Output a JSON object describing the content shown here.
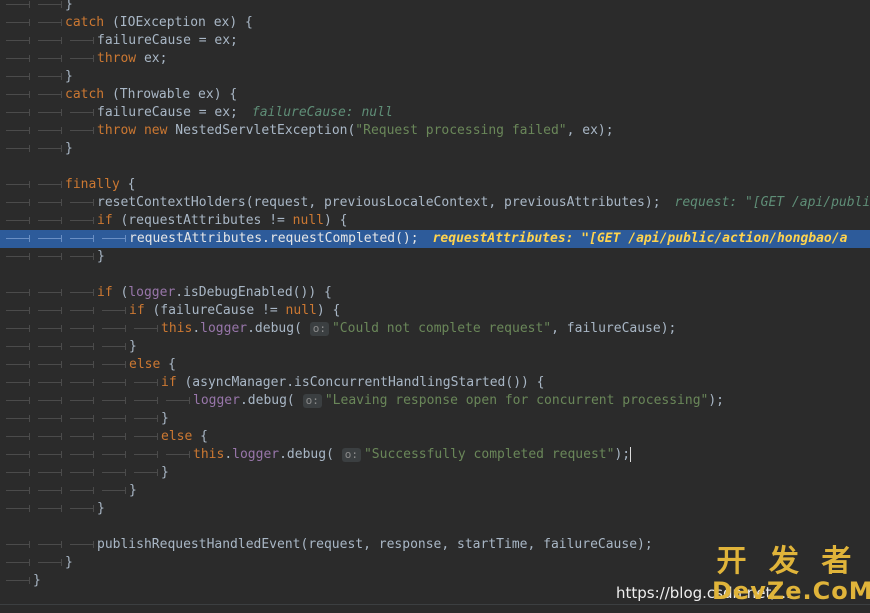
{
  "editor": {
    "lines": [
      {
        "indent": 2,
        "segs": [
          [
            "p",
            "}"
          ]
        ]
      },
      {
        "indent": 2,
        "segs": [
          [
            "k",
            "catch"
          ],
          [
            "p",
            " (IOException ex) {"
          ]
        ]
      },
      {
        "indent": 3,
        "segs": [
          [
            "p",
            "failureCause = ex;"
          ]
        ]
      },
      {
        "indent": 3,
        "segs": [
          [
            "k",
            "throw"
          ],
          [
            "p",
            " ex;"
          ]
        ]
      },
      {
        "indent": 2,
        "segs": [
          [
            "p",
            "}"
          ]
        ]
      },
      {
        "indent": 2,
        "segs": [
          [
            "k",
            "catch"
          ],
          [
            "p",
            " (Throwable ex) {"
          ]
        ]
      },
      {
        "indent": 3,
        "segs": [
          [
            "p",
            "failureCause = ex;"
          ],
          [
            "h",
            "failureCause: null"
          ]
        ]
      },
      {
        "indent": 3,
        "segs": [
          [
            "k",
            "throw new"
          ],
          [
            "p",
            " NestedServletException("
          ],
          [
            "s",
            "\"Request processing failed\""
          ],
          [
            "p",
            ", ex);"
          ]
        ]
      },
      {
        "indent": 2,
        "segs": [
          [
            "p",
            "}"
          ]
        ]
      },
      {
        "indent": 0,
        "segs": []
      },
      {
        "indent": 2,
        "segs": [
          [
            "k",
            "finally"
          ],
          [
            "p",
            " {"
          ]
        ]
      },
      {
        "indent": 3,
        "segs": [
          [
            "p",
            "resetContextHolders(request, previousLocaleContext, previousAttributes);"
          ],
          [
            "h",
            "request: \"[GET /api/public/action/hongbao/"
          ]
        ]
      },
      {
        "indent": 3,
        "segs": [
          [
            "k",
            "if"
          ],
          [
            "p",
            " (requestAttributes != "
          ],
          [
            "k",
            "null"
          ],
          [
            "p",
            ") {"
          ]
        ]
      },
      {
        "indent": 4,
        "hl": true,
        "segs": [
          [
            "p",
            "requestAttributes.requestCompleted();"
          ],
          [
            "h",
            "requestAttributes: \"[GET /api/public/action/hongbao/a"
          ]
        ]
      },
      {
        "indent": 3,
        "segs": [
          [
            "p",
            "}"
          ]
        ]
      },
      {
        "indent": 0,
        "segs": []
      },
      {
        "indent": 3,
        "segs": [
          [
            "k",
            "if"
          ],
          [
            "p",
            " ("
          ],
          [
            "f",
            "logger"
          ],
          [
            "p",
            ".isDebugEnabled()) {"
          ]
        ]
      },
      {
        "indent": 4,
        "segs": [
          [
            "k",
            "if"
          ],
          [
            "p",
            " (failureCause != "
          ],
          [
            "k",
            "null"
          ],
          [
            "p",
            ") {"
          ]
        ]
      },
      {
        "indent": 5,
        "segs": [
          [
            "k",
            "this"
          ],
          [
            "p",
            "."
          ],
          [
            "f",
            "logger"
          ],
          [
            "p",
            ".debug( "
          ],
          [
            "m",
            "o:"
          ],
          [
            "s",
            "\"Could not complete request\""
          ],
          [
            "p",
            ", failureCause);"
          ]
        ]
      },
      {
        "indent": 4,
        "segs": [
          [
            "p",
            "}"
          ]
        ]
      },
      {
        "indent": 4,
        "segs": [
          [
            "k",
            "else"
          ],
          [
            "p",
            " {"
          ]
        ]
      },
      {
        "indent": 5,
        "segs": [
          [
            "k",
            "if"
          ],
          [
            "p",
            " (asyncManager.isConcurrentHandlingStarted()) {"
          ]
        ]
      },
      {
        "indent": 6,
        "segs": [
          [
            "f",
            "logger"
          ],
          [
            "p",
            ".debug( "
          ],
          [
            "m",
            "o:"
          ],
          [
            "s",
            "\"Leaving response open for concurrent processing\""
          ],
          [
            "p",
            ");"
          ]
        ]
      },
      {
        "indent": 5,
        "segs": [
          [
            "p",
            "}"
          ]
        ]
      },
      {
        "indent": 5,
        "segs": [
          [
            "k",
            "else"
          ],
          [
            "p",
            " {"
          ]
        ]
      },
      {
        "indent": 6,
        "segs": [
          [
            "k",
            "this"
          ],
          [
            "p",
            "."
          ],
          [
            "f",
            "logger"
          ],
          [
            "p",
            ".debug( "
          ],
          [
            "m",
            "o:"
          ],
          [
            "s",
            "\"Successfully completed request\""
          ],
          [
            "p",
            ");"
          ],
          [
            "c",
            ""
          ]
        ]
      },
      {
        "indent": 5,
        "segs": [
          [
            "p",
            "}"
          ]
        ]
      },
      {
        "indent": 4,
        "segs": [
          [
            "p",
            "}"
          ]
        ]
      },
      {
        "indent": 3,
        "segs": [
          [
            "p",
            "}"
          ]
        ]
      },
      {
        "indent": 0,
        "segs": []
      },
      {
        "indent": 3,
        "segs": [
          [
            "p",
            "publishRequestHandledEvent(request, response, startTime, failureCause);"
          ]
        ]
      },
      {
        "indent": 2,
        "segs": [
          [
            "p",
            "}"
          ]
        ]
      },
      {
        "indent": 1,
        "segs": [
          [
            "p",
            "}"
          ]
        ]
      },
      {
        "indent": 0,
        "segs": []
      }
    ]
  },
  "watermark": {
    "url_text": "https://blog.csdn.net/...",
    "logo_cn": "开 发 者",
    "logo_en": "DevZe.CoM"
  },
  "colors": {
    "background": "#2b2b2b",
    "keyword": "#cc7832",
    "string": "#6a8759",
    "field": "#9876aa",
    "highlight_line": "#2d5b9a"
  }
}
